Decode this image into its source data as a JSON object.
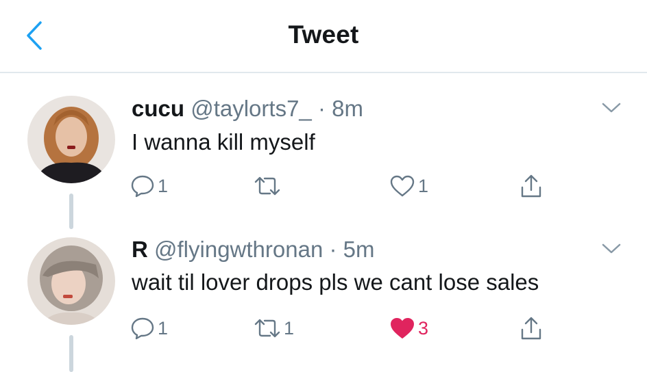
{
  "header": {
    "back_icon": "chevron-left-icon",
    "title": "Tweet"
  },
  "colors": {
    "accent": "#1da1f2",
    "text": "#14171a",
    "secondary": "#657786",
    "like_active": "#e0245e",
    "divider": "#e1e8ed",
    "thread_line": "#ccd6dd"
  },
  "tweets": [
    {
      "display_name": "cucu",
      "handle": "@taylorts7_",
      "time": "8m",
      "text": "I wanna kill myself",
      "reply_count": "1",
      "retweet_count": "",
      "like_count": "1",
      "liked": false
    },
    {
      "display_name": "R",
      "handle": "@flyingwthronan",
      "time": "5m",
      "text": "wait til lover drops pls we cant lose sales",
      "reply_count": "1",
      "retweet_count": "1",
      "like_count": "3",
      "liked": true
    }
  ]
}
